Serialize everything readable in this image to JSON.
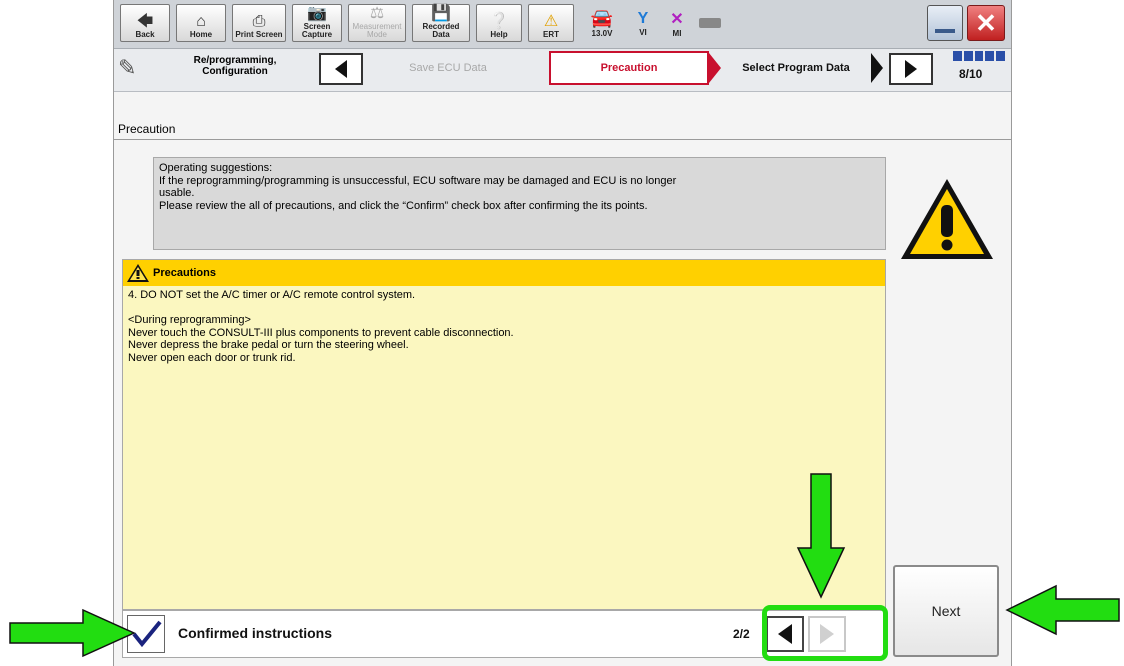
{
  "toolbar": {
    "back": "Back",
    "home": "Home",
    "print_screen": "Print Screen",
    "screen_capture": "Screen\nCapture",
    "measurement_mode": "Measurement\nMode",
    "recorded_data": "Recorded\nData",
    "help": "Help",
    "ert": "ERT",
    "voltage": "13.0V",
    "vi": "VI",
    "mi": "MI"
  },
  "nav": {
    "section_title": "Re/programming,\nConfiguration",
    "steps": [
      "Save ECU Data",
      "Precaution",
      "Select Program Data"
    ],
    "step_counter": "8/10"
  },
  "page_title": "Precaution",
  "suggestions": {
    "lines": [
      "Operating  suggestions:",
      "If the reprogramming/programming is unsuccessful, ECU software may be damaged and ECU is no longer",
      "usable.",
      "Please review the all of precautions, and click the “Confirm” check box after confirming the its points."
    ]
  },
  "precautions": {
    "heading": "Precautions",
    "lines": [
      "4. DO NOT set the A/C timer or A/C remote control system.",
      "",
      "<During  reprogramming>",
      "Never touch the CONSULT-III plus components to prevent cable disconnection.",
      "Never depress the brake pedal or turn the steering wheel.",
      "Never open each door or trunk rid."
    ]
  },
  "confirm": {
    "label": "Confirmed instructions",
    "checked": true
  },
  "pager": {
    "text": "2/2"
  },
  "next_button": "Next",
  "colors": {
    "active_step_border": "#c8102e",
    "precaution_header": "#ffd000",
    "precaution_bg": "#fbf7c0",
    "highlight_green": "#22dd11",
    "check_mark": "#1a237e"
  }
}
